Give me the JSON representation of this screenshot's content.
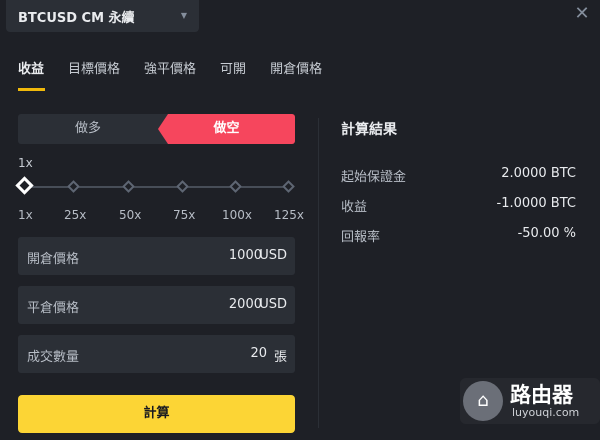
{
  "header": {
    "symbol": "BTCUSD CM 永續",
    "close_icon": "close-icon",
    "caret_icon": "caret-down-icon"
  },
  "tabs": [
    {
      "label": "收益",
      "active": true
    },
    {
      "label": "目標價格",
      "active": false
    },
    {
      "label": "強平價格",
      "active": false
    },
    {
      "label": "可開",
      "active": false
    },
    {
      "label": "開倉價格",
      "active": false
    }
  ],
  "side": {
    "long_label": "做多",
    "short_label": "做空",
    "selected": "short"
  },
  "leverage": {
    "value_label": "1x",
    "value": 1,
    "min": 1,
    "max": 125,
    "ticks": [
      "1x",
      "25x",
      "50x",
      "75x",
      "100x",
      "125x"
    ]
  },
  "inputs": {
    "entry_price": {
      "label": "開倉價格",
      "value": "1000",
      "unit": "USD"
    },
    "exit_price": {
      "label": "平倉價格",
      "value": "2000",
      "unit": "USD"
    },
    "quantity": {
      "label": "成交數量",
      "value": "20",
      "unit": "張"
    }
  },
  "calculate_label": "計算",
  "result": {
    "title": "計算結果",
    "rows": [
      {
        "label": "起始保證金",
        "value": "2.0000 BTC"
      },
      {
        "label": "收益",
        "value": "-1.0000 BTC"
      },
      {
        "label": "回報率",
        "value": "-50.00 %"
      }
    ]
  },
  "watermark": {
    "name": "路由器",
    "url": "luyouqi.com",
    "icon": "router-logo-icon"
  },
  "colors": {
    "accent": "#f0b90b",
    "button": "#fcd535",
    "short": "#f6465d",
    "background": "#1e2026",
    "panel": "#2b2f36"
  }
}
